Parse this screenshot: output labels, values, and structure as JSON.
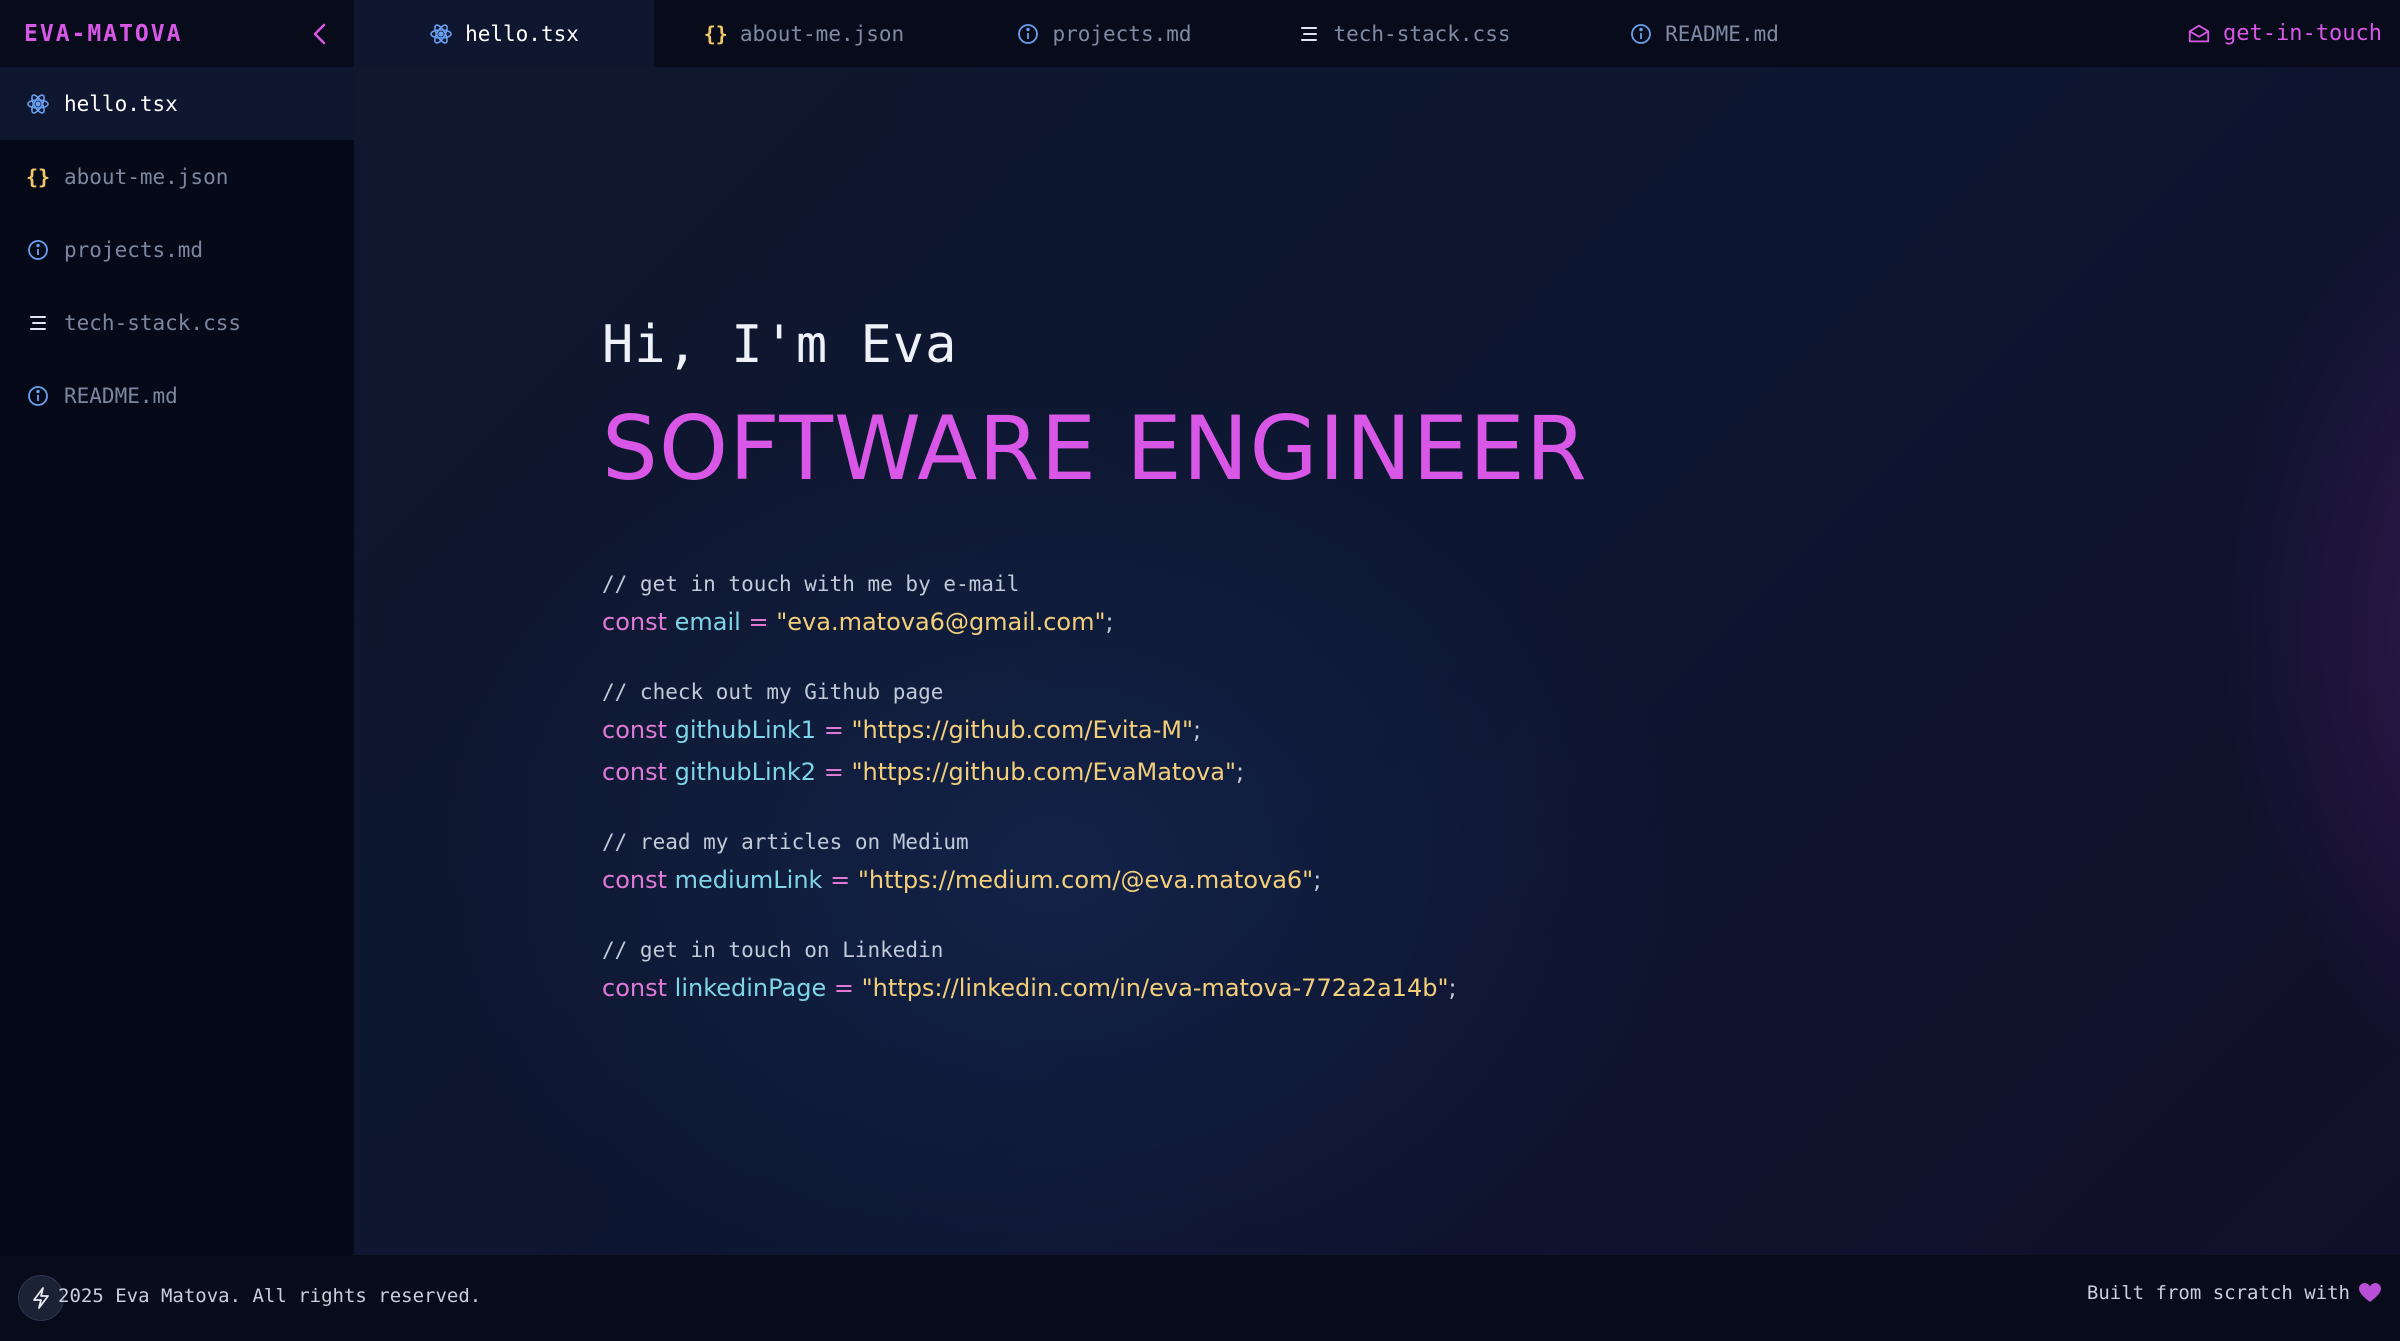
{
  "brand": {
    "name": "EVA-MATOVA",
    "collapse_glyph": "‹"
  },
  "tabs": [
    {
      "label": "hello.tsx",
      "icon": "react-icon",
      "active": true
    },
    {
      "label": "about-me.json",
      "icon": "braces-icon",
      "active": false
    },
    {
      "label": "projects.md",
      "icon": "info-icon",
      "active": false
    },
    {
      "label": "tech-stack.css",
      "icon": "lines-icon",
      "active": false
    },
    {
      "label": "README.md",
      "icon": "info-icon",
      "active": false
    }
  ],
  "contact": {
    "label": "get-in-touch",
    "icon": "mail-icon"
  },
  "sidebar": {
    "items": [
      {
        "label": "hello.tsx"
      },
      {
        "label": "about-me.json"
      },
      {
        "label": "projects.md"
      },
      {
        "label": "tech-stack.css"
      },
      {
        "label": "README.md"
      }
    ]
  },
  "hero": {
    "greeting": "Hi, I'm Eva",
    "title": "SOFTWARE ENGINEER"
  },
  "code": {
    "email_comment": "// get in touch with me by e-mail",
    "github_comment": "// check out my Github page",
    "medium_comment": "// read my articles on Medium",
    "linkedin_comment": "// get in touch on Linkedin",
    "kw": "const",
    "eq": "=",
    "semi": ";",
    "email_var": "email",
    "email_val": "\"eva.matova6@gmail.com\"",
    "gh1_var": "githubLink1",
    "gh1_val": "\"https://github.com/Evita-M\"",
    "gh2_var": "githubLink2",
    "gh2_val": "\"https://github.com/EvaMatova\"",
    "medium_var": "mediumLink",
    "medium_val": "\"https://medium.com/@eva.matova6\"",
    "linkedin_var": "linkedinPage",
    "linkedin_val": "\"https://linkedin.com/in/eva-matova-772a2a14b\""
  },
  "footer": {
    "copyright": "2025 Eva Matova. All rights reserved.",
    "built": "Built from scratch with"
  },
  "colors": {
    "accent": "#d957e6",
    "string": "#f3cf7a",
    "variable": "#7fd5e8"
  }
}
